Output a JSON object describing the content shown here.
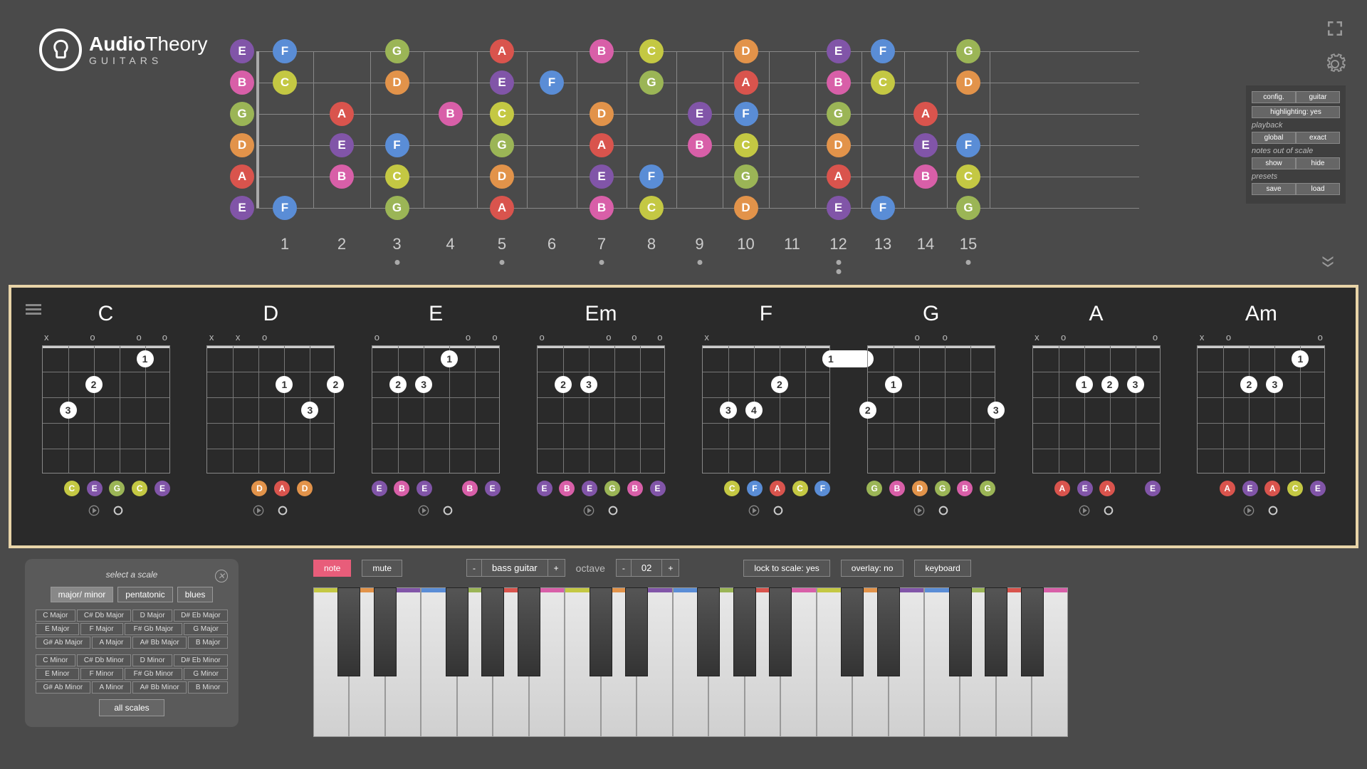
{
  "app": {
    "name_bold": "Audio",
    "name_light": "Theory",
    "sub": "GUITARS"
  },
  "note_colors": {
    "C": "#c4c843",
    "D": "#e2934a",
    "E": "#8155a8",
    "F": "#5a8dd6",
    "G": "#9bb556",
    "A": "#d9544d",
    "B": "#d85fa8"
  },
  "fretboard": {
    "frets": 15,
    "fret_spacings": [
      0,
      80,
      160,
      235,
      310,
      380,
      450,
      520,
      590,
      655,
      720,
      785,
      850,
      910,
      970,
      1030,
      1090,
      1150,
      1210
    ],
    "strings": [
      "E",
      "B",
      "G",
      "D",
      "A",
      "E"
    ],
    "notes": [
      {
        "s": 0,
        "f": 0,
        "n": "E"
      },
      {
        "s": 0,
        "f": 1,
        "n": "F"
      },
      {
        "s": 0,
        "f": 3,
        "n": "G"
      },
      {
        "s": 0,
        "f": 5,
        "n": "A"
      },
      {
        "s": 0,
        "f": 7,
        "n": "B"
      },
      {
        "s": 0,
        "f": 8,
        "n": "C"
      },
      {
        "s": 0,
        "f": 10,
        "n": "D"
      },
      {
        "s": 0,
        "f": 12,
        "n": "E"
      },
      {
        "s": 0,
        "f": 13,
        "n": "F"
      },
      {
        "s": 0,
        "f": 15,
        "n": "G"
      },
      {
        "s": 1,
        "f": 0,
        "n": "B"
      },
      {
        "s": 1,
        "f": 1,
        "n": "C"
      },
      {
        "s": 1,
        "f": 3,
        "n": "D"
      },
      {
        "s": 1,
        "f": 5,
        "n": "E"
      },
      {
        "s": 1,
        "f": 6,
        "n": "F"
      },
      {
        "s": 1,
        "f": 8,
        "n": "G"
      },
      {
        "s": 1,
        "f": 10,
        "n": "A"
      },
      {
        "s": 1,
        "f": 12,
        "n": "B"
      },
      {
        "s": 1,
        "f": 13,
        "n": "C"
      },
      {
        "s": 1,
        "f": 15,
        "n": "D"
      },
      {
        "s": 2,
        "f": 0,
        "n": "G"
      },
      {
        "s": 2,
        "f": 2,
        "n": "A"
      },
      {
        "s": 2,
        "f": 4,
        "n": "B"
      },
      {
        "s": 2,
        "f": 5,
        "n": "C"
      },
      {
        "s": 2,
        "f": 7,
        "n": "D"
      },
      {
        "s": 2,
        "f": 9,
        "n": "E"
      },
      {
        "s": 2,
        "f": 10,
        "n": "F"
      },
      {
        "s": 2,
        "f": 12,
        "n": "G"
      },
      {
        "s": 2,
        "f": 14,
        "n": "A"
      },
      {
        "s": 3,
        "f": 0,
        "n": "D"
      },
      {
        "s": 3,
        "f": 2,
        "n": "E"
      },
      {
        "s": 3,
        "f": 3,
        "n": "F"
      },
      {
        "s": 3,
        "f": 5,
        "n": "G"
      },
      {
        "s": 3,
        "f": 7,
        "n": "A"
      },
      {
        "s": 3,
        "f": 9,
        "n": "B"
      },
      {
        "s": 3,
        "f": 10,
        "n": "C"
      },
      {
        "s": 3,
        "f": 12,
        "n": "D"
      },
      {
        "s": 3,
        "f": 14,
        "n": "E"
      },
      {
        "s": 3,
        "f": 15,
        "n": "F"
      },
      {
        "s": 4,
        "f": 0,
        "n": "A"
      },
      {
        "s": 4,
        "f": 2,
        "n": "B"
      },
      {
        "s": 4,
        "f": 3,
        "n": "C"
      },
      {
        "s": 4,
        "f": 5,
        "n": "D"
      },
      {
        "s": 4,
        "f": 7,
        "n": "E"
      },
      {
        "s": 4,
        "f": 8,
        "n": "F"
      },
      {
        "s": 4,
        "f": 10,
        "n": "G"
      },
      {
        "s": 4,
        "f": 12,
        "n": "A"
      },
      {
        "s": 4,
        "f": 14,
        "n": "B"
      },
      {
        "s": 4,
        "f": 15,
        "n": "C"
      },
      {
        "s": 5,
        "f": 0,
        "n": "E"
      },
      {
        "s": 5,
        "f": 1,
        "n": "F"
      },
      {
        "s": 5,
        "f": 3,
        "n": "G"
      },
      {
        "s": 5,
        "f": 5,
        "n": "A"
      },
      {
        "s": 5,
        "f": 7,
        "n": "B"
      },
      {
        "s": 5,
        "f": 8,
        "n": "C"
      },
      {
        "s": 5,
        "f": 10,
        "n": "D"
      },
      {
        "s": 5,
        "f": 12,
        "n": "E"
      },
      {
        "s": 5,
        "f": 13,
        "n": "F"
      },
      {
        "s": 5,
        "f": 15,
        "n": "G"
      }
    ],
    "markers": [
      3,
      5,
      7,
      9,
      12,
      15
    ],
    "double_marker": 12
  },
  "settings": {
    "config": "config.",
    "guitar": "guitar",
    "highlighting": "highlighting: yes",
    "playback_label": "playback",
    "global": "global",
    "exact": "exact",
    "oos_label": "notes out of scale",
    "show": "show",
    "hide": "hide",
    "presets_label": "presets",
    "save": "save",
    "load": "load"
  },
  "chords": [
    {
      "name": "C",
      "markers": [
        "x",
        "",
        "o",
        "",
        "o",
        "o"
      ],
      "fingers": [
        {
          "s": 4,
          "f": 1,
          "n": "1"
        },
        {
          "s": 2,
          "f": 2,
          "n": "2"
        },
        {
          "s": 1,
          "f": 3,
          "n": "3"
        }
      ],
      "notes": [
        "",
        "C",
        "E",
        "G",
        "C",
        "E"
      ]
    },
    {
      "name": "D",
      "markers": [
        "x",
        "x",
        "o",
        "",
        "",
        ""
      ],
      "fingers": [
        {
          "s": 3,
          "f": 2,
          "n": "1"
        },
        {
          "s": 5,
          "f": 2,
          "n": "2"
        },
        {
          "s": 4,
          "f": 3,
          "n": "3"
        }
      ],
      "notes": [
        "",
        "",
        "D",
        "A",
        "D",
        ""
      ]
    },
    {
      "name": "E",
      "markers": [
        "o",
        "",
        "",
        "",
        "o",
        "o"
      ],
      "fingers": [
        {
          "s": 3,
          "f": 1,
          "n": "1"
        },
        {
          "s": 1,
          "f": 2,
          "n": "2"
        },
        {
          "s": 2,
          "f": 2,
          "n": "3"
        }
      ],
      "notes": [
        "E",
        "B",
        "E",
        "",
        "B",
        "E"
      ]
    },
    {
      "name": "Em",
      "markers": [
        "o",
        "",
        "",
        "o",
        "o",
        "o"
      ],
      "fingers": [
        {
          "s": 1,
          "f": 2,
          "n": "2"
        },
        {
          "s": 2,
          "f": 2,
          "n": "3"
        }
      ],
      "notes": [
        "E",
        "B",
        "E",
        "G",
        "B",
        "E"
      ]
    },
    {
      "name": "F",
      "markers": [
        "x",
        "",
        "",
        "",
        "",
        ""
      ],
      "fingers": [
        {
          "s": 5,
          "f": 1,
          "n": "1",
          "barre": 2
        },
        {
          "s": 3,
          "f": 2,
          "n": "2"
        },
        {
          "s": 1,
          "f": 3,
          "n": "3"
        },
        {
          "s": 2,
          "f": 3,
          "n": "4"
        }
      ],
      "notes": [
        "",
        "C",
        "F",
        "A",
        "C",
        "F"
      ]
    },
    {
      "name": "G",
      "markers": [
        "",
        "",
        "o",
        "o",
        "",
        ""
      ],
      "fingers": [
        {
          "s": 1,
          "f": 2,
          "n": "1"
        },
        {
          "s": 0,
          "f": 3,
          "n": "2"
        },
        {
          "s": 5,
          "f": 3,
          "n": "3"
        }
      ],
      "notes": [
        "G",
        "B",
        "D",
        "G",
        "B",
        "G"
      ]
    },
    {
      "name": "A",
      "markers": [
        "x",
        "o",
        "",
        "",
        "",
        "o"
      ],
      "fingers": [
        {
          "s": 2,
          "f": 2,
          "n": "1"
        },
        {
          "s": 3,
          "f": 2,
          "n": "2"
        },
        {
          "s": 4,
          "f": 2,
          "n": "3"
        }
      ],
      "notes": [
        "",
        "A",
        "E",
        "A",
        "",
        "E"
      ]
    },
    {
      "name": "Am",
      "markers": [
        "x",
        "o",
        "",
        "",
        "",
        "o"
      ],
      "fingers": [
        {
          "s": 4,
          "f": 1,
          "n": "1"
        },
        {
          "s": 2,
          "f": 2,
          "n": "2"
        },
        {
          "s": 3,
          "f": 2,
          "n": "3"
        }
      ],
      "notes": [
        "",
        "A",
        "E",
        "A",
        "C",
        "E"
      ]
    }
  ],
  "scale_panel": {
    "title": "select a scale",
    "tabs": [
      "major/ minor",
      "pentatonic",
      "blues"
    ],
    "majors": [
      "C Major",
      "C# Db Major",
      "D Major",
      "D# Eb Major",
      "E Major",
      "F Major",
      "F# Gb Major",
      "G Major",
      "G# Ab Major",
      "A Major",
      "A# Bb Major",
      "B Major"
    ],
    "minors": [
      "C Minor",
      "C# Db Minor",
      "D Minor",
      "D# Eb Minor",
      "E Minor",
      "F Minor",
      "F# Gb Minor",
      "G Minor",
      "G# Ab Minor",
      "A Minor",
      "A# Bb Minor",
      "B Minor"
    ],
    "all": "all scales"
  },
  "kb": {
    "note": "note",
    "mute": "mute",
    "bass": "bass guitar",
    "octave_label": "octave",
    "octave": "02",
    "lock": "lock to scale: yes",
    "overlay": "overlay: no",
    "keyboard": "keyboard",
    "minus": "-",
    "plus": "+"
  },
  "keyboard": {
    "white_count": 21,
    "white_colors": [
      "C",
      "D",
      "E",
      "F",
      "G",
      "A",
      "B",
      "C",
      "D",
      "E",
      "F",
      "G",
      "A",
      "B",
      "C",
      "D",
      "E",
      "F",
      "G",
      "A",
      "B"
    ],
    "blacks": [
      0,
      1,
      3,
      4,
      5,
      7,
      8,
      10,
      11,
      12,
      14,
      15,
      17,
      18,
      19
    ]
  }
}
